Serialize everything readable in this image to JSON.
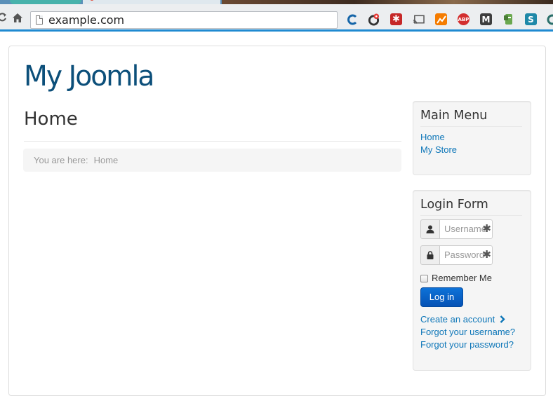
{
  "browser": {
    "url": "example.com",
    "extensions": [
      "c-icon",
      "chrome-sync-icon",
      "lastpass-icon",
      "cast-icon",
      "analytics-icon",
      "adblock-plus-icon",
      "gmail-icon",
      "evernote-icon",
      "s-extension-icon",
      "circle-extension-icon"
    ],
    "extension_labels": {
      "abp": "ABP",
      "m": "M",
      "s": "S"
    },
    "accent_color": "#1f8ad1"
  },
  "site": {
    "title": "My Joomla",
    "title_color": "#0c4f7a"
  },
  "main": {
    "heading": "Home",
    "breadcrumb": {
      "prefix": "You are here:",
      "current": "Home"
    }
  },
  "main_menu": {
    "title": "Main Menu",
    "items": [
      {
        "label": "Home"
      },
      {
        "label": "My Store"
      }
    ]
  },
  "login_form": {
    "title": "Login Form",
    "username_placeholder": "Username",
    "password_placeholder": "Password",
    "required_marker": "✱",
    "remember_me": "Remember Me",
    "remember_me_checked": false,
    "submit_label": "Log in",
    "links": [
      {
        "label": "Create an account"
      },
      {
        "label": "Forgot your username?"
      },
      {
        "label": "Forgot your password?"
      }
    ]
  }
}
